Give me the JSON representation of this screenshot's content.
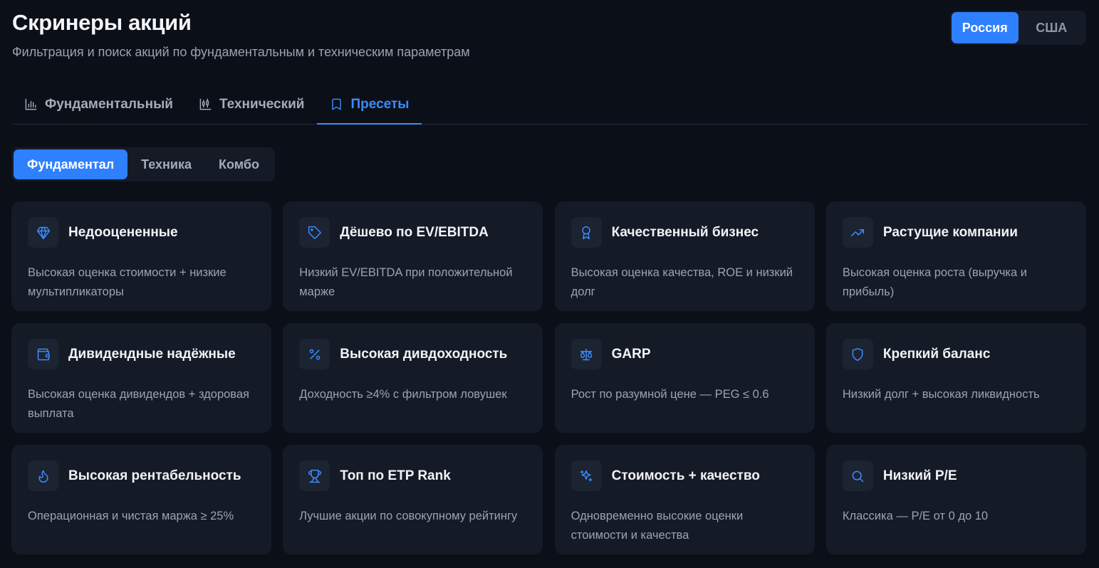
{
  "header": {
    "title": "Скринеры акций",
    "subtitle": "Фильтрация и поиск акций по фундаментальным и техническим параметрам"
  },
  "market": {
    "options": [
      "Россия",
      "США"
    ],
    "selected": "Россия"
  },
  "tabs": [
    {
      "label": "Фундаментальный",
      "icon": "bar-chart-icon"
    },
    {
      "label": "Технический",
      "icon": "candlestick-chart-icon"
    },
    {
      "label": "Пресеты",
      "icon": "bookmark-icon",
      "active": true
    }
  ],
  "subtabs": [
    {
      "label": "Фундаментал",
      "active": true
    },
    {
      "label": "Техника"
    },
    {
      "label": "Комбо"
    }
  ],
  "presets": [
    {
      "title": "Недооцененные",
      "desc": "Высокая оценка стоимости + низкие мультипликаторы",
      "icon": "gem-icon"
    },
    {
      "title": "Дёшево по EV/EBITDA",
      "desc": "Низкий EV/EBITDA при положительной марже",
      "icon": "tag-icon"
    },
    {
      "title": "Качественный бизнес",
      "desc": "Высокая оценка качества, ROE и низкий долг",
      "icon": "award-icon"
    },
    {
      "title": "Растущие компании",
      "desc": "Высокая оценка роста (выручка и прибыль)",
      "icon": "trending-up-icon"
    },
    {
      "title": "Дивидендные надёжные",
      "desc": "Высокая оценка дивидендов + здоровая выплата",
      "icon": "wallet-icon"
    },
    {
      "title": "Высокая дивдоходность",
      "desc": "Доходность ≥4% с фильтром ловушек",
      "icon": "percent-icon"
    },
    {
      "title": "GARP",
      "desc": "Рост по разумной цене — PEG ≤ 0.6",
      "icon": "scale-icon"
    },
    {
      "title": "Крепкий баланс",
      "desc": "Низкий долг + высокая ликвидность",
      "icon": "shield-icon"
    },
    {
      "title": "Высокая рентабельность",
      "desc": "Операционная и чистая маржа ≥ 25%",
      "icon": "flame-icon"
    },
    {
      "title": "Топ по ETP Rank",
      "desc": "Лучшие акции по совокупному рейтингу",
      "icon": "trophy-icon"
    },
    {
      "title": "Стоимость + качество",
      "desc": "Одновременно высокие оценки стоимости и качества",
      "icon": "sparkles-icon"
    },
    {
      "title": "Низкий P/E",
      "desc": "Классика — P/E от 0 до 10",
      "icon": "search-icon"
    }
  ],
  "colors": {
    "accent": "#2f80ff",
    "background": "#0b0f17",
    "card": "#151b26"
  }
}
